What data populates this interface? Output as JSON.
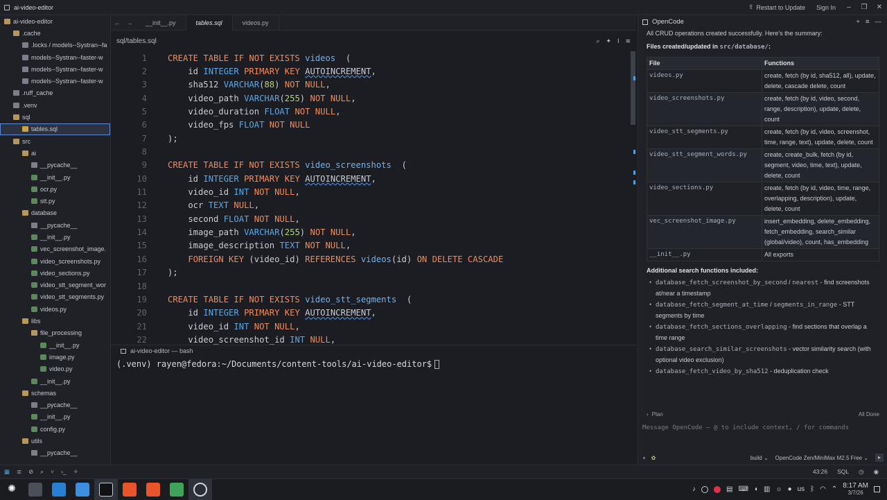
{
  "window": {
    "title": "ai-video-editor",
    "restart_label": "Restart to Update",
    "signin_label": "Sign In"
  },
  "sidebar": {
    "items": [
      {
        "label": "ai-video-editor",
        "depth": 0,
        "kind": "folder-open"
      },
      {
        "label": ".cache",
        "depth": 1,
        "kind": "folder-open"
      },
      {
        "label": ".locks / models--Systran--fa",
        "depth": 2,
        "kind": "folder"
      },
      {
        "label": "models--Systran--faster-w",
        "depth": 2,
        "kind": "folder"
      },
      {
        "label": "models--Systran--faster-w",
        "depth": 2,
        "kind": "folder"
      },
      {
        "label": "models--Systran--faster-w",
        "depth": 2,
        "kind": "folder"
      },
      {
        "label": ".ruff_cache",
        "depth": 1,
        "kind": "folder"
      },
      {
        "label": ".venv",
        "depth": 1,
        "kind": "folder"
      },
      {
        "label": "sql",
        "depth": 1,
        "kind": "folder-open"
      },
      {
        "label": "tables.sql",
        "depth": 2,
        "kind": "sql",
        "selected": true
      },
      {
        "label": "src",
        "depth": 1,
        "kind": "folder-open"
      },
      {
        "label": "ai",
        "depth": 2,
        "kind": "folder-open"
      },
      {
        "label": "__pycache__",
        "depth": 3,
        "kind": "folder"
      },
      {
        "label": "__init__.py",
        "depth": 3,
        "kind": "py"
      },
      {
        "label": "ocr.py",
        "depth": 3,
        "kind": "py"
      },
      {
        "label": "stt.py",
        "depth": 3,
        "kind": "py"
      },
      {
        "label": "database",
        "depth": 2,
        "kind": "folder-open"
      },
      {
        "label": "__pycache__",
        "depth": 3,
        "kind": "folder"
      },
      {
        "label": "__init__.py",
        "depth": 3,
        "kind": "py"
      },
      {
        "label": "vec_screenshot_image.",
        "depth": 3,
        "kind": "py"
      },
      {
        "label": "video_screenshots.py",
        "depth": 3,
        "kind": "py"
      },
      {
        "label": "video_sections.py",
        "depth": 3,
        "kind": "py"
      },
      {
        "label": "video_stt_segment_wor",
        "depth": 3,
        "kind": "py"
      },
      {
        "label": "video_stt_segments.py",
        "depth": 3,
        "kind": "py"
      },
      {
        "label": "videos.py",
        "depth": 3,
        "kind": "py"
      },
      {
        "label": "libs",
        "depth": 2,
        "kind": "folder-open"
      },
      {
        "label": "file_processing",
        "depth": 3,
        "kind": "folder-open"
      },
      {
        "label": "__init__.py",
        "depth": 4,
        "kind": "py"
      },
      {
        "label": "image.py",
        "depth": 4,
        "kind": "py"
      },
      {
        "label": "video.py",
        "depth": 4,
        "kind": "py"
      },
      {
        "label": "__init__.py",
        "depth": 3,
        "kind": "py"
      },
      {
        "label": "schemas",
        "depth": 2,
        "kind": "folder-open"
      },
      {
        "label": "__pycache__",
        "depth": 3,
        "kind": "folder"
      },
      {
        "label": "__init__.py",
        "depth": 3,
        "kind": "py"
      },
      {
        "label": "config.py",
        "depth": 3,
        "kind": "py"
      },
      {
        "label": "utils",
        "depth": 2,
        "kind": "folder-open"
      },
      {
        "label": "__pycache__",
        "depth": 3,
        "kind": "folder"
      }
    ]
  },
  "tabs": [
    {
      "label": "__init__.py",
      "active": false
    },
    {
      "label": "tables.sql",
      "active": true
    },
    {
      "label": "videos.py",
      "active": false
    }
  ],
  "breadcrumb": "sql/tables.sql",
  "code": [
    {
      "n": "1",
      "t": [
        [
          "kw",
          "CREATE TABLE IF NOT EXISTS "
        ],
        [
          "tbl",
          "videos"
        ],
        [
          "",
          "  ("
        ]
      ]
    },
    {
      "n": "2",
      "t": [
        [
          "",
          "    id "
        ],
        [
          "ty",
          "INTEGER "
        ],
        [
          "kw",
          "PRIMARY KEY "
        ],
        [
          "wv",
          "AUTOINCREMENT"
        ],
        [
          "",
          ","
        ]
      ]
    },
    {
      "n": "3",
      "t": [
        [
          "",
          "    sha512 "
        ],
        [
          "ty",
          "VARCHAR"
        ],
        [
          "",
          "("
        ],
        [
          "nm",
          "88"
        ],
        [
          "",
          ") "
        ],
        [
          "kw",
          "NOT NULL"
        ],
        [
          "",
          ","
        ]
      ]
    },
    {
      "n": "4",
      "t": [
        [
          "",
          "    video_path "
        ],
        [
          "ty",
          "VARCHAR"
        ],
        [
          "",
          "("
        ],
        [
          "nm",
          "255"
        ],
        [
          "",
          ") "
        ],
        [
          "kw",
          "NOT NULL"
        ],
        [
          "",
          ","
        ]
      ]
    },
    {
      "n": "5",
      "t": [
        [
          "",
          "    video_duration "
        ],
        [
          "ty",
          "FLOAT "
        ],
        [
          "kw",
          "NOT NULL"
        ],
        [
          "",
          ","
        ]
      ]
    },
    {
      "n": "6",
      "t": [
        [
          "",
          "    video_fps "
        ],
        [
          "ty",
          "FLOAT "
        ],
        [
          "kw",
          "NOT NULL"
        ]
      ]
    },
    {
      "n": "7",
      "t": [
        [
          "",
          ");"
        ]
      ]
    },
    {
      "n": "8",
      "t": [
        [
          "",
          ""
        ]
      ]
    },
    {
      "n": "9",
      "t": [
        [
          "kw",
          "CREATE TABLE IF NOT EXISTS "
        ],
        [
          "tbl",
          "video_screenshots"
        ],
        [
          "",
          "  ("
        ]
      ]
    },
    {
      "n": "10",
      "t": [
        [
          "",
          "    id "
        ],
        [
          "ty",
          "INTEGER "
        ],
        [
          "kw",
          "PRIMARY KEY "
        ],
        [
          "wv",
          "AUTOINCREMENT"
        ],
        [
          "",
          ","
        ]
      ]
    },
    {
      "n": "11",
      "t": [
        [
          "",
          "    video_id "
        ],
        [
          "ty",
          "INT "
        ],
        [
          "kw",
          "NOT NULL"
        ],
        [
          "",
          ","
        ]
      ]
    },
    {
      "n": "12",
      "t": [
        [
          "",
          "    ocr "
        ],
        [
          "ty",
          "TEXT "
        ],
        [
          "kw",
          "NULL"
        ],
        [
          "",
          ","
        ]
      ]
    },
    {
      "n": "13",
      "t": [
        [
          "",
          "    second "
        ],
        [
          "ty",
          "FLOAT "
        ],
        [
          "kw",
          "NOT NULL"
        ],
        [
          "",
          ","
        ]
      ]
    },
    {
      "n": "14",
      "t": [
        [
          "",
          "    image_path "
        ],
        [
          "ty",
          "VARCHAR"
        ],
        [
          "",
          "("
        ],
        [
          "nm",
          "255"
        ],
        [
          "",
          ") "
        ],
        [
          "kw",
          "NOT NULL"
        ],
        [
          "",
          ","
        ]
      ]
    },
    {
      "n": "15",
      "t": [
        [
          "",
          "    image_description "
        ],
        [
          "ty",
          "TEXT "
        ],
        [
          "kw",
          "NOT NULL"
        ],
        [
          "",
          ","
        ]
      ]
    },
    {
      "n": "16",
      "t": [
        [
          "kw",
          "    FOREIGN KEY "
        ],
        [
          "",
          "(video_id) "
        ],
        [
          "kw",
          "REFERENCES "
        ],
        [
          "tbl",
          "videos"
        ],
        [
          "",
          "(id) "
        ],
        [
          "kw",
          "ON DELETE CASCADE"
        ]
      ]
    },
    {
      "n": "17",
      "t": [
        [
          "",
          ");"
        ]
      ]
    },
    {
      "n": "18",
      "t": [
        [
          "",
          ""
        ]
      ]
    },
    {
      "n": "19",
      "t": [
        [
          "kw",
          "CREATE TABLE IF NOT EXISTS "
        ],
        [
          "tbl",
          "video_stt_segments"
        ],
        [
          "",
          "  ("
        ]
      ]
    },
    {
      "n": "20",
      "t": [
        [
          "",
          "    id "
        ],
        [
          "ty",
          "INTEGER "
        ],
        [
          "kw",
          "PRIMARY KEY "
        ],
        [
          "wv",
          "AUTOINCREMENT"
        ],
        [
          "",
          ","
        ]
      ]
    },
    {
      "n": "21",
      "t": [
        [
          "",
          "    video_id "
        ],
        [
          "ty",
          "INT "
        ],
        [
          "kw",
          "NOT NULL"
        ],
        [
          "",
          ","
        ]
      ]
    },
    {
      "n": "22",
      "t": [
        [
          "",
          "    video_screenshot_id "
        ],
        [
          "ty",
          "INT "
        ],
        [
          "kw",
          "NULL"
        ],
        [
          "",
          ","
        ]
      ]
    }
  ],
  "terminal": {
    "tab_label": "ai-video-editor — bash",
    "prompt": "(.venv) rayen@fedora:~/Documents/content-tools/ai-video-editor$"
  },
  "panel": {
    "title": "OpenCode",
    "intro": "All CRUD operations created successfully. Here's the summary:",
    "files_heading_pre": "Files created/updated in ",
    "files_heading_code": "src/database/",
    "files_heading_post": ":",
    "table_headers": [
      "File",
      "Functions"
    ],
    "rows": [
      {
        "file": "videos.py",
        "fn": "create, fetch (by id, sha512, all), update, delete, cascade delete, count"
      },
      {
        "file": "video_screenshots.py",
        "fn": "create, fetch (by id, video, second, range, description), update, delete, count"
      },
      {
        "file": "video_stt_segments.py",
        "fn": "create, fetch (by id, video, screenshot, time, range, text), update, delete, count"
      },
      {
        "file": "video_stt_segment_words.py",
        "fn": "create, create_bulk, fetch (by id, segment, video, time, text), update, delete, count"
      },
      {
        "file": "video_sections.py",
        "fn": "create, fetch (by id, video, time, range, overlapping, description), update, delete, count"
      },
      {
        "file": "vec_screenshot_image.py",
        "fn": "insert_embedding, delete_embedding, fetch_embedding, search_similar (global/video), count, has_embedding"
      },
      {
        "file": "__init__.py",
        "fn": "All exports"
      }
    ],
    "additional_heading": "Additional search functions included:",
    "bullets": [
      {
        "code": "database_fetch_screenshot_by_second",
        "sep": " / ",
        "code2": "nearest",
        "text": " - find screenshots at/near a timestamp"
      },
      {
        "code": "database_fetch_segment_at_time",
        "sep": " / ",
        "code2": "segments_in_range",
        "text": " - STT segments by time"
      },
      {
        "code": "database_fetch_sections_overlapping",
        "sep": "",
        "code2": "",
        "text": " - find sections that overlap a time range"
      },
      {
        "code": "database_search_similar_screenshots",
        "sep": "",
        "code2": "",
        "text": " - vector similarity search (with optional video exclusion)"
      },
      {
        "code": "database_fetch_video_by_sha512",
        "sep": "",
        "code2": "",
        "text": " - deduplication check"
      }
    ],
    "plan_label": "Plan",
    "plan_status": "All Done",
    "input_placeholder": "Message OpenCode — @ to include context, / for commands",
    "mode": "build",
    "model": "OpenCode Zen/MiniMax M2.5 Free"
  },
  "status": {
    "cursor": "43:26",
    "language": "SQL"
  },
  "tray": {
    "keyboard": "us",
    "time": "8:17 AM",
    "date": "3/7/26"
  }
}
